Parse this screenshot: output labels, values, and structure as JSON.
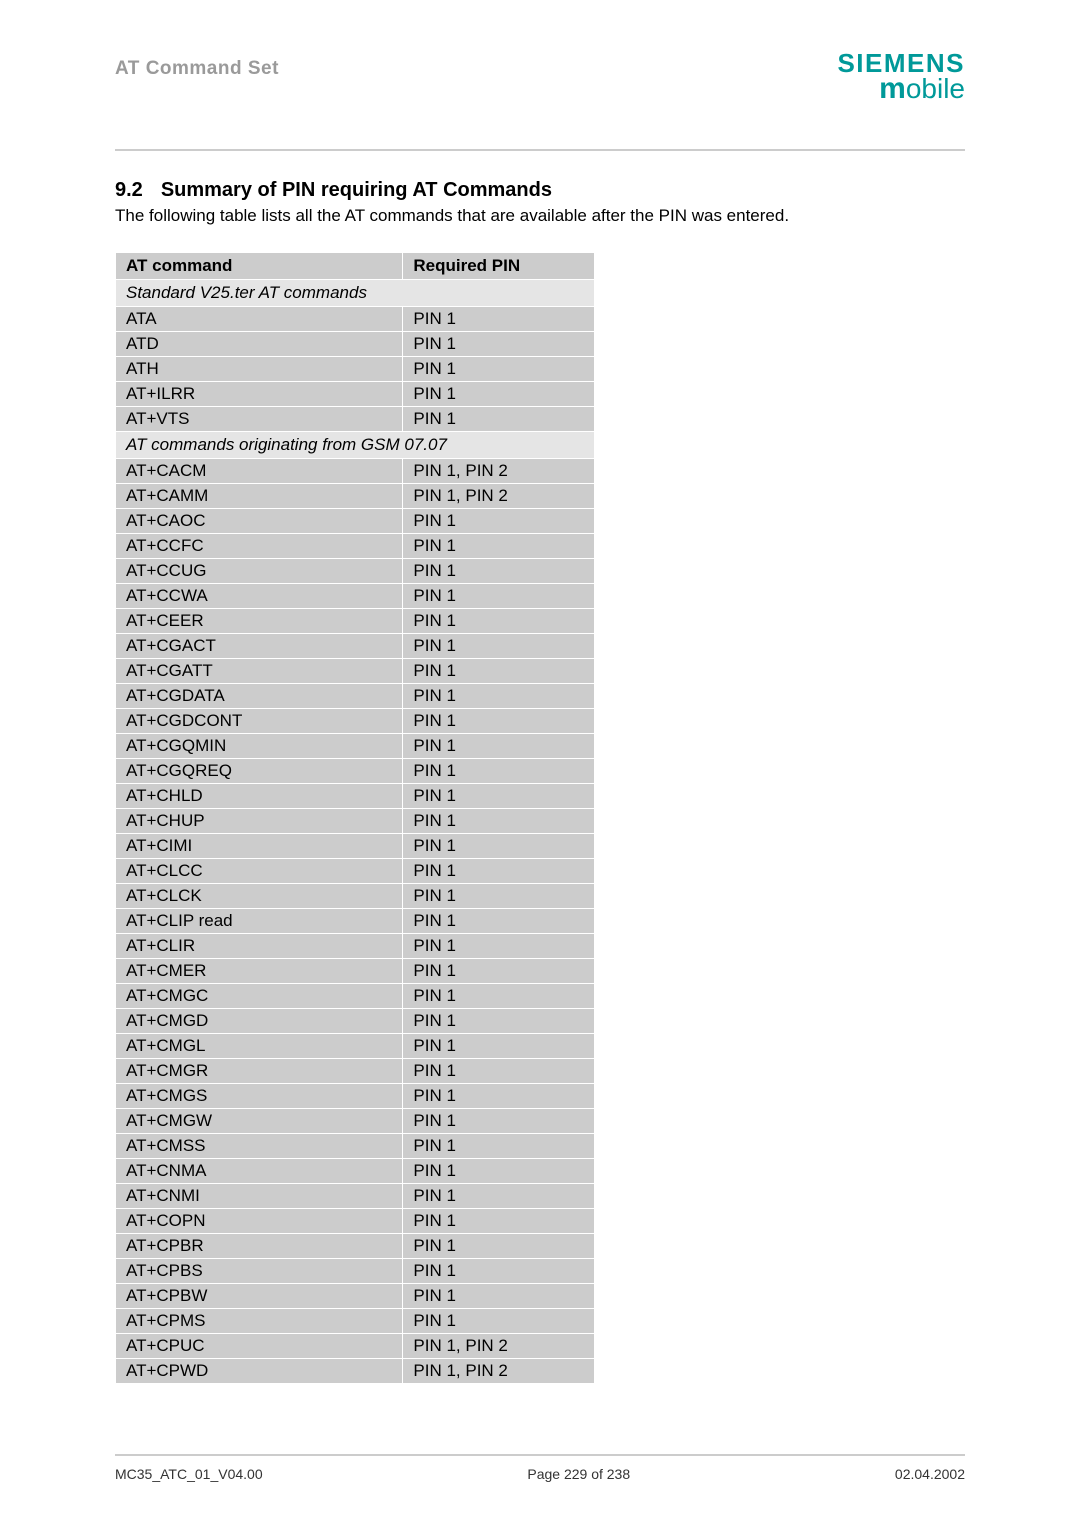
{
  "header": {
    "doc_title": "AT Command Set",
    "logo_top": "SIEMENS",
    "logo_bottom_m": "m",
    "logo_bottom_rest": "obile"
  },
  "section": {
    "number": "9.2",
    "title": "Summary of PIN requiring AT Commands",
    "intro": "The following table lists all the AT commands that are available after the PIN was entered."
  },
  "table": {
    "headers": {
      "cmd": "AT command",
      "pin": "Required PIN"
    },
    "groups": [
      {
        "label": "Standard V25.ter AT commands",
        "rows": [
          {
            "cmd": "ATA",
            "pin": "PIN 1"
          },
          {
            "cmd": "ATD",
            "pin": "PIN 1"
          },
          {
            "cmd": "ATH",
            "pin": "PIN 1"
          },
          {
            "cmd": "AT+ILRR",
            "pin": "PIN 1"
          },
          {
            "cmd": "AT+VTS",
            "pin": "PIN 1"
          }
        ]
      },
      {
        "label": "AT commands originating from GSM 07.07",
        "rows": [
          {
            "cmd": "AT+CACM",
            "pin": "PIN 1, PIN 2"
          },
          {
            "cmd": "AT+CAMM",
            "pin": "PIN 1, PIN 2"
          },
          {
            "cmd": "AT+CAOC",
            "pin": "PIN 1"
          },
          {
            "cmd": "AT+CCFC",
            "pin": "PIN 1"
          },
          {
            "cmd": "AT+CCUG",
            "pin": "PIN 1"
          },
          {
            "cmd": "AT+CCWA",
            "pin": "PIN 1"
          },
          {
            "cmd": "AT+CEER",
            "pin": "PIN 1"
          },
          {
            "cmd": "AT+CGACT",
            "pin": "PIN 1"
          },
          {
            "cmd": "AT+CGATT",
            "pin": "PIN 1"
          },
          {
            "cmd": "AT+CGDATA",
            "pin": "PIN 1"
          },
          {
            "cmd": "AT+CGDCONT",
            "pin": "PIN 1"
          },
          {
            "cmd": "AT+CGQMIN",
            "pin": "PIN 1"
          },
          {
            "cmd": "AT+CGQREQ",
            "pin": "PIN 1"
          },
          {
            "cmd": "AT+CHLD",
            "pin": "PIN 1"
          },
          {
            "cmd": "AT+CHUP",
            "pin": "PIN 1"
          },
          {
            "cmd": "AT+CIMI",
            "pin": "PIN 1"
          },
          {
            "cmd": "AT+CLCC",
            "pin": "PIN 1"
          },
          {
            "cmd": "AT+CLCK",
            "pin": "PIN 1"
          },
          {
            "cmd": "AT+CLIP read",
            "pin": "PIN 1"
          },
          {
            "cmd": "AT+CLIR",
            "pin": "PIN 1"
          },
          {
            "cmd": "AT+CMER",
            "pin": "PIN 1"
          },
          {
            "cmd": "AT+CMGC",
            "pin": "PIN 1"
          },
          {
            "cmd": "AT+CMGD",
            "pin": "PIN 1"
          },
          {
            "cmd": "AT+CMGL",
            "pin": "PIN 1"
          },
          {
            "cmd": "AT+CMGR",
            "pin": "PIN 1"
          },
          {
            "cmd": "AT+CMGS",
            "pin": "PIN 1"
          },
          {
            "cmd": "AT+CMGW",
            "pin": "PIN 1"
          },
          {
            "cmd": "AT+CMSS",
            "pin": "PIN 1"
          },
          {
            "cmd": "AT+CNMA",
            "pin": "PIN 1"
          },
          {
            "cmd": "AT+CNMI",
            "pin": "PIN 1"
          },
          {
            "cmd": "AT+COPN",
            "pin": "PIN 1"
          },
          {
            "cmd": "AT+CPBR",
            "pin": "PIN 1"
          },
          {
            "cmd": "AT+CPBS",
            "pin": "PIN 1"
          },
          {
            "cmd": "AT+CPBW",
            "pin": "PIN 1"
          },
          {
            "cmd": "AT+CPMS",
            "pin": "PIN 1"
          },
          {
            "cmd": "AT+CPUC",
            "pin": "PIN 1, PIN 2"
          },
          {
            "cmd": "AT+CPWD",
            "pin": "PIN 1, PIN 2"
          }
        ]
      }
    ]
  },
  "footer": {
    "left": "MC35_ATC_01_V04.00",
    "center": "Page 229 of 238",
    "right": "02.04.2002"
  }
}
